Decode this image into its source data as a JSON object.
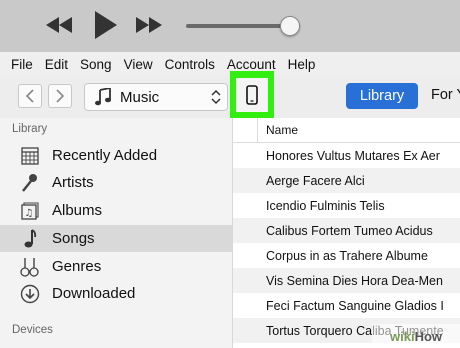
{
  "player": {
    "controls": [
      "previous-icon",
      "play-icon",
      "next-icon"
    ],
    "volume_level": 0.93
  },
  "menubar": {
    "items": [
      {
        "label": "File"
      },
      {
        "label": "Edit"
      },
      {
        "label": "Song"
      },
      {
        "label": "View"
      },
      {
        "label": "Controls"
      },
      {
        "label": "Account"
      },
      {
        "label": "Help"
      }
    ]
  },
  "toolbar": {
    "media_selector": "Music",
    "library_label": "Library",
    "for_you_label": "For Y",
    "highlight_color": "#33ee11",
    "accent_color": "#2870d6"
  },
  "sidebar": {
    "library_header": "Library",
    "items": [
      {
        "label": "Recently Added",
        "icon": "calendar-grid-icon"
      },
      {
        "label": "Artists",
        "icon": "microphone-icon"
      },
      {
        "label": "Albums",
        "icon": "album-icon"
      },
      {
        "label": "Songs",
        "icon": "music-note-icon",
        "selected": true
      },
      {
        "label": "Genres",
        "icon": "guitars-icon"
      },
      {
        "label": "Downloaded",
        "icon": "download-icon"
      }
    ],
    "devices_header": "Devices"
  },
  "songs": {
    "column_header": "Name",
    "rows": [
      "Honores Vultus Mutares Ex Aer",
      "Aerge Facere Alci",
      "Icendio Fulminis Telis",
      "Calibus Fortem Tumeo Acidus",
      "Corpus in as Trahere Albume",
      "Vis Semina Dies Hora Dea-Men",
      "Feci Factum Sanguine Gladios I",
      "Tortus Torquero Caliba Tumente"
    ]
  },
  "watermark": {
    "prefix": "wiki",
    "suffix": "How"
  }
}
